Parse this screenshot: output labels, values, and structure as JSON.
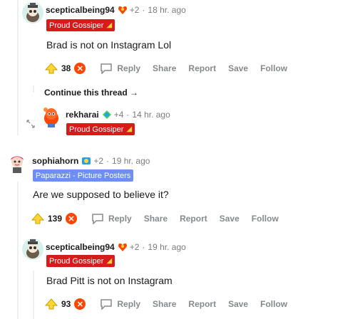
{
  "comments": [
    {
      "username": "scepticalbeing94",
      "award_count": "+2",
      "time": "18 hr. ago",
      "flair": "Proud Gossiper",
      "text": "Brad is not on Instagram Lol",
      "score": "38"
    },
    {
      "username": "rekharai",
      "award_count": "+4",
      "time": "14 hr. ago",
      "flair": "Proud Gossiper"
    },
    {
      "username": "sophiahorn",
      "award_count": "+2",
      "time": "19 hr. ago",
      "flair": "Paparazzi - Picture Posters",
      "text": "Are we supposed to believe it?",
      "score": "139"
    },
    {
      "username": "scepticalbeing94",
      "award_count": "+2",
      "time": "19 hr. ago",
      "flair": "Proud Gossiper",
      "text": "Brad Pitt is not on Instagram",
      "score": "93"
    }
  ],
  "actions": {
    "reply": "Reply",
    "share": "Share",
    "report": "Report",
    "save": "Save",
    "follow": "Follow"
  },
  "continue_thread": "Continue this thread",
  "separator": "·",
  "colors": {
    "accent": "#ff4500",
    "flair_red": "#d71a1a",
    "flair_blue": "#6c8ef5",
    "muted": "#878a8c"
  }
}
